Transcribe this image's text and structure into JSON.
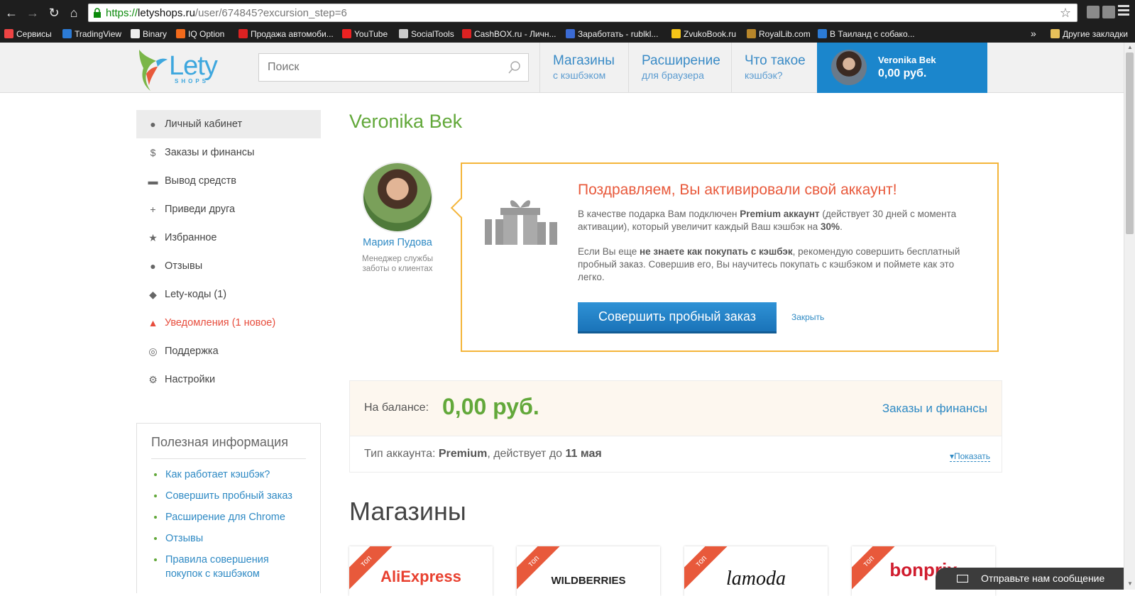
{
  "browser": {
    "url": {
      "scheme": "https://",
      "host": "letyshops.ru",
      "path": "/user/674845?excursion_step=6"
    },
    "bookmarks": [
      {
        "label": "Сервисы",
        "color": "#e44"
      },
      {
        "label": "TradingView",
        "color": "#2c7bd6"
      },
      {
        "label": "Binary",
        "color": "#eee"
      },
      {
        "label": "IQ Option",
        "color": "#f26a1b"
      },
      {
        "label": "Продажа автомоби...",
        "color": "#d22"
      },
      {
        "label": "YouTube",
        "color": "#e22"
      },
      {
        "label": "SocialTools",
        "color": "#ccc"
      },
      {
        "label": "CashBOX.ru - Личн...",
        "color": "#d22"
      },
      {
        "label": "Заработать - rublkl...",
        "color": "#3b6bd4"
      },
      {
        "label": "ZvukoBook.ru",
        "color": "#f5c518"
      },
      {
        "label": "RoyalLib.com",
        "color": "#b8862a"
      },
      {
        "label": "В Таиланд с собако...",
        "color": "#2c7bd6"
      }
    ],
    "bookmarks_more": "»",
    "other_bookmarks": "Другие закладки"
  },
  "header": {
    "logo_text": "Lety",
    "logo_sub": "SHOPS",
    "search_placeholder": "Поиск",
    "nav": [
      {
        "title": "Магазины",
        "subtitle": "с кэшбэком"
      },
      {
        "title": "Расширение",
        "subtitle": "для браузера"
      },
      {
        "title": "Что такое",
        "subtitle": "кэшбэк?"
      }
    ],
    "user": {
      "name": "Veronika Bek",
      "balance": "0,00 руб."
    }
  },
  "sidebar": {
    "items": [
      {
        "label": "Личный кабинет",
        "icon": "user-icon"
      },
      {
        "label": "Заказы и финансы",
        "icon": "dollar-icon"
      },
      {
        "label": "Вывод средств",
        "icon": "card-icon"
      },
      {
        "label": "Приведи друга",
        "icon": "add-user-icon"
      },
      {
        "label": "Избранное",
        "icon": "star-icon"
      },
      {
        "label": "Отзывы",
        "icon": "comments-icon"
      },
      {
        "label": "Lety-коды (1)",
        "icon": "tags-icon"
      },
      {
        "label": "Уведомления (1 новое)",
        "icon": "bell-icon"
      },
      {
        "label": "Поддержка",
        "icon": "lifebuoy-icon"
      },
      {
        "label": "Настройки",
        "icon": "gear-icon"
      }
    ],
    "info": {
      "title": "Полезная информация",
      "links": [
        "Как работает кэшбэк?",
        "Совершить пробный заказ",
        "Расширение для Chrome",
        "Отзывы",
        "Правила совершения покупок с кэшбэком"
      ]
    }
  },
  "main": {
    "title": "Veronika Bek",
    "manager": {
      "name": "Мария Пудова",
      "role": "Менеджер службы заботы о клиентах"
    },
    "promo": {
      "heading": "Поздравляем, Вы активировали свой аккаунт!",
      "p1_a": "В качестве подарка Вам подключен ",
      "p1_b": "Premium аккаунт",
      "p1_c": " (действует 30 дней с момента активации), который увеличит каждый Ваш кэшбэк на ",
      "p1_d": "30%",
      "p1_e": ".",
      "p2_a": "Если Вы еще ",
      "p2_b": "не знаете как покупать с кэшбэк",
      "p2_c": ", рекомендую совершить бесплатный пробный заказ. Совершив его, Вы научитесь покупать с кэшбэком и поймете как это легко.",
      "button": "Совершить пробный заказ",
      "close": "Закрыть"
    },
    "balance": {
      "label": "На балансе:",
      "value": "0,00 руб.",
      "link": "Заказы и финансы",
      "type_a": "Тип аккаунта: ",
      "type_b": "Premium",
      "type_c": ", действует до ",
      "type_d": "11 мая",
      "show": "Показать"
    },
    "stores_title": "Магазины",
    "stores": [
      {
        "badge": "топ",
        "name": "AliExpress",
        "color": "#e8402f"
      },
      {
        "badge": "топ",
        "name": "WILDBERRIES",
        "color": "#222"
      },
      {
        "badge": "топ",
        "name": "lamoda",
        "color": "#111"
      },
      {
        "badge": "топ",
        "name": "bonprix",
        "color": "#d01c2e"
      }
    ]
  },
  "chat": {
    "label": "Отправьте нам сообщение"
  }
}
